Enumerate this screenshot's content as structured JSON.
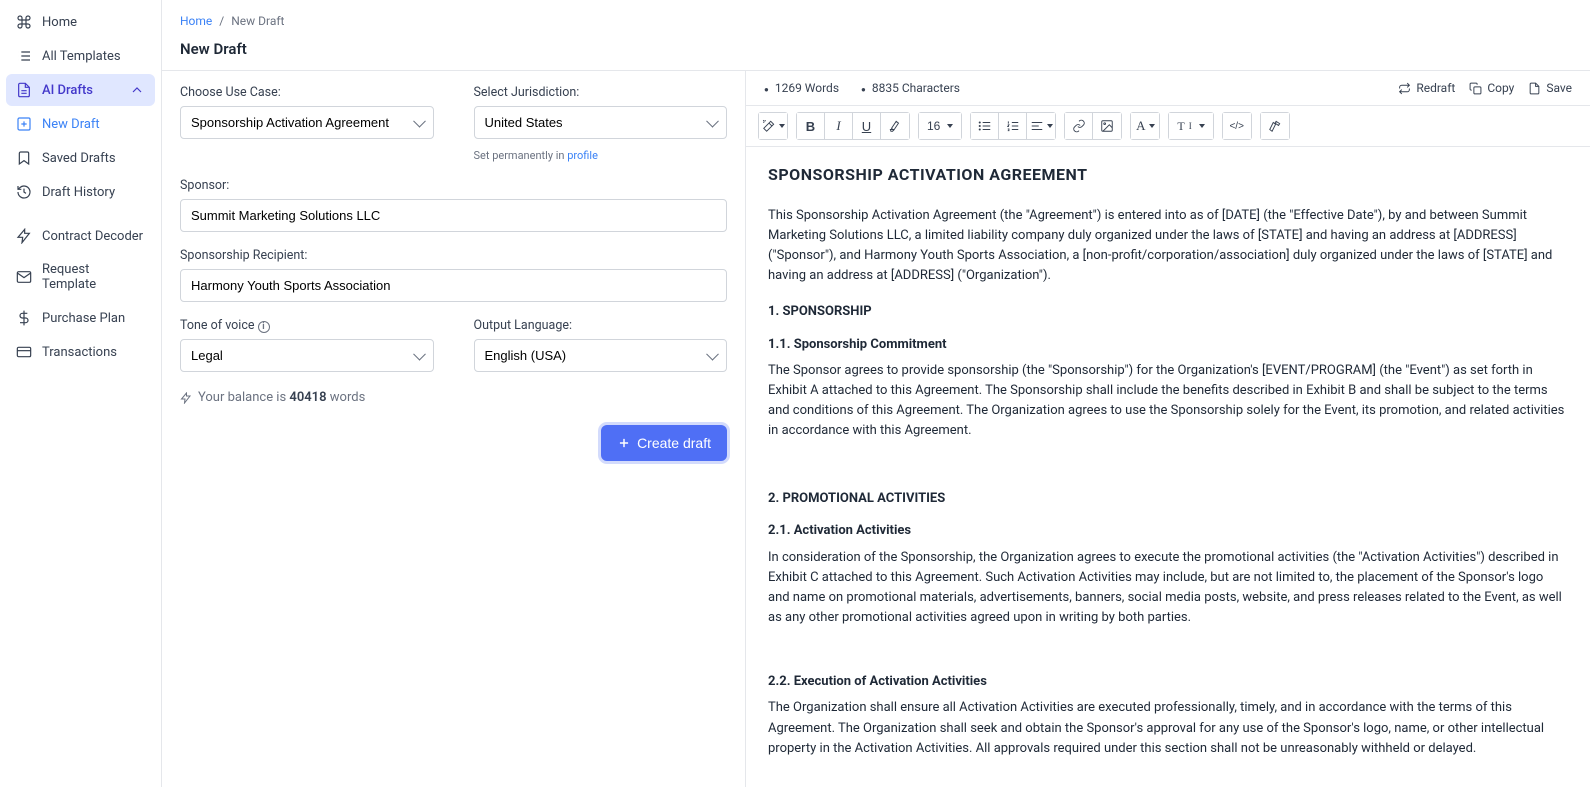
{
  "sidebar": {
    "home": "Home",
    "all_templates": "All Templates",
    "ai_drafts": "AI Drafts",
    "new_draft": "New Draft",
    "saved_drafts": "Saved Drafts",
    "draft_history": "Draft History",
    "contract_decoder": "Contract Decoder",
    "request_template": "Request Template",
    "purchase_plan": "Purchase Plan",
    "transactions": "Transactions"
  },
  "breadcrumb": {
    "home": "Home",
    "sep": "/",
    "current": "New Draft"
  },
  "page": {
    "title": "New Draft"
  },
  "form": {
    "use_case_label": "Choose Use Case:",
    "use_case_value": "Sponsorship Activation Agreement",
    "jurisdiction_label": "Select Jurisdiction:",
    "jurisdiction_value": "United States",
    "jurisdiction_hint_prefix": "Set permanently in ",
    "jurisdiction_hint_link": "profile",
    "sponsor_label": "Sponsor:",
    "sponsor_value": "Summit Marketing Solutions LLC",
    "recipient_label": "Sponsorship Recipient:",
    "recipient_value": "Harmony Youth Sports Association",
    "tone_label": "Tone of voice",
    "tone_value": "Legal",
    "lang_label": "Output Language:",
    "lang_value": "English (USA)",
    "balance_prefix": "Your balance is ",
    "balance_number": "40418",
    "balance_suffix": " words",
    "create_btn": "Create draft"
  },
  "stats": {
    "words": "1269 Words",
    "chars": "8835 Characters",
    "redraft": "Redraft",
    "copy": "Copy",
    "save": "Save"
  },
  "toolbar": {
    "font_size": "16"
  },
  "doc": {
    "title": "SPONSORSHIP ACTIVATION AGREEMENT",
    "p1": "This Sponsorship Activation Agreement (the \"Agreement\") is entered into as of [DATE] (the \"Effective Date\"), by and between Summit Marketing Solutions LLC, a limited liability company duly organized under the laws of [STATE] and having an address at [ADDRESS] (\"Sponsor\"), and Harmony Youth Sports Association, a [non-profit/corporation/association] duly organized under the laws of [STATE] and having an address at [ADDRESS] (\"Organization\").",
    "h1": "1. SPONSORSHIP",
    "h1_1": "1.1. Sponsorship Commitment",
    "p2": "The Sponsor agrees to provide sponsorship (the \"Sponsorship\") for the Organization's [EVENT/PROGRAM] (the \"Event\") as set forth in Exhibit A attached to this Agreement. The Sponsorship shall include the benefits described in Exhibit B and shall be subject to the terms and conditions of this Agreement. The Organization agrees to use the Sponsorship solely for the Event, its promotion, and related activities in accordance with this Agreement.",
    "h2": "2. PROMOTIONAL ACTIVITIES",
    "h2_1": "2.1. Activation Activities",
    "p3": "In consideration of the Sponsorship, the Organization agrees to execute the promotional activities (the \"Activation Activities\") described in Exhibit C attached to this Agreement. Such Activation Activities may include, but are not limited to, the placement of the Sponsor's logo and name on promotional materials, advertisements, banners, social media posts, website, and press releases related to the Event, as well as any other promotional activities agreed upon in writing by both parties.",
    "h2_2": "2.2. Execution of Activation Activities",
    "p4": "The Organization shall ensure all Activation Activities are executed professionally, timely, and in accordance with the terms of this Agreement. The Organization shall seek and obtain the Sponsor's approval for any use of the Sponsor's logo, name, or other intellectual property in the Activation Activities. All approvals required under this section shall not be unreasonably withheld or delayed."
  }
}
